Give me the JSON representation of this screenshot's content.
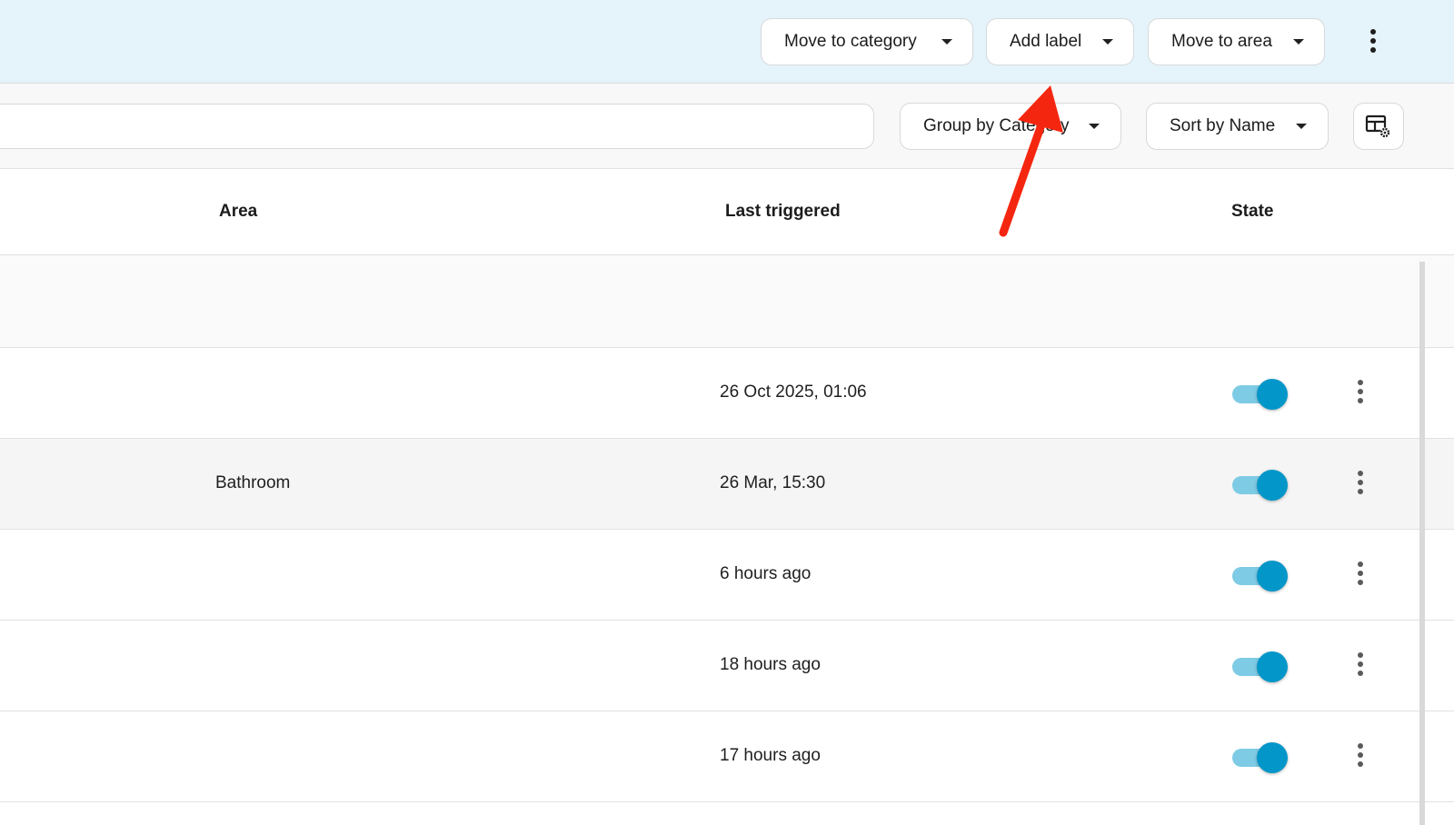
{
  "toolbar": {
    "move_category_label": "Move to category",
    "add_label_label": "Add label",
    "move_area_label": "Move to area"
  },
  "filters": {
    "search_value": "",
    "group_by_label": "Group by Category",
    "sort_by_label": "Sort by Name"
  },
  "columns": {
    "area": "Area",
    "last_triggered": "Last triggered",
    "state": "State"
  },
  "rows": [
    {
      "area": "",
      "last_triggered": "26 Oct 2025, 01:06",
      "state": true
    },
    {
      "area": "Bathroom",
      "last_triggered": "26 Mar, 15:30",
      "state": true
    },
    {
      "area": "",
      "last_triggered": "6 hours ago",
      "state": true
    },
    {
      "area": "",
      "last_triggered": "18 hours ago",
      "state": true
    },
    {
      "area": "",
      "last_triggered": "17 hours ago",
      "state": true
    }
  ],
  "icons": {
    "overflow": "more-vertical-icon",
    "dropdown": "caret-down-icon",
    "table_settings": "table-settings-icon",
    "annotation": "red-arrow-annotation"
  },
  "colors": {
    "toolbar_bg": "#e5f3fa",
    "toggle_on": "#0396c9",
    "toggle_track": "#7ecbe5",
    "annotation_arrow": "#f5260f"
  }
}
